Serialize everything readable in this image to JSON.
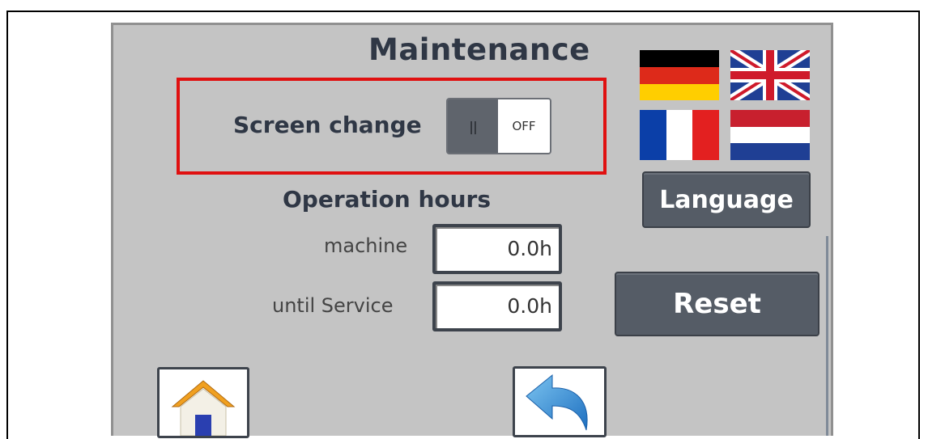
{
  "title": "Maintenance",
  "screen_change": {
    "label": "Screen change",
    "knob_glyph": "||",
    "state": "OFF"
  },
  "operation_hours": {
    "heading": "Operation hours",
    "machine": {
      "label": "machine",
      "value": "0.0h"
    },
    "until_service": {
      "label": "until Service",
      "value": "0.0h"
    }
  },
  "languages": [
    "german-flag-icon",
    "uk-flag-icon",
    "france-flag-icon",
    "netherlands-flag-icon"
  ],
  "buttons": {
    "language": "Language",
    "reset": "Reset"
  },
  "nav": {
    "home_icon": "home-icon",
    "back_icon": "back-arrow-icon"
  },
  "colors": {
    "panel": "#c4c4c4",
    "button": "#555c66",
    "text": "#2f3745",
    "highlight": "#e01010"
  }
}
